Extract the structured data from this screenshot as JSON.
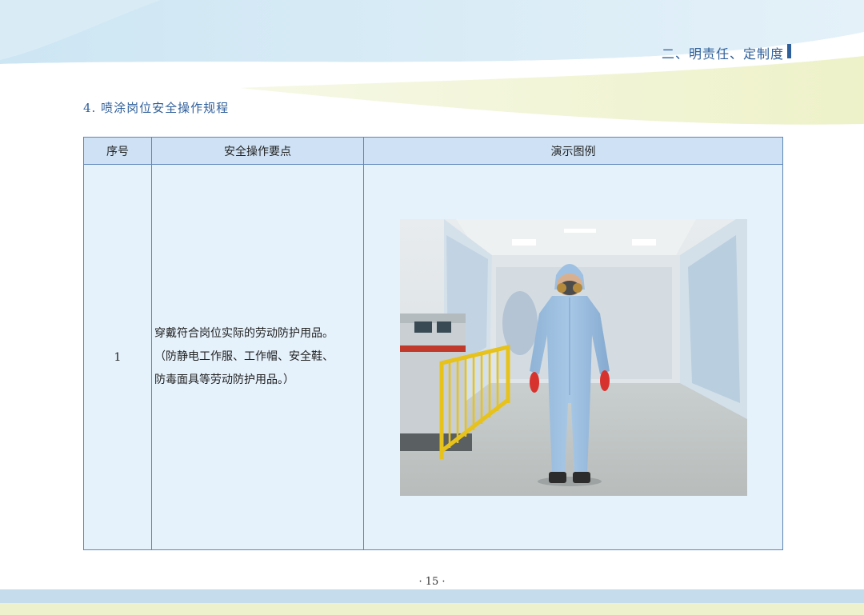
{
  "header": {
    "chapter_title": "二、明责任、定制度",
    "chapter_mark": "Ⅱ"
  },
  "section": {
    "title": "4. 喷涂岗位安全操作规程"
  },
  "table": {
    "headers": [
      "序号",
      "安全操作要点",
      "演示图例"
    ],
    "rows": [
      {
        "no": "1",
        "lines": [
          "穿戴符合岗位实际的劳动防护用品。",
          "（防静电工作服、工作帽、安全鞋、",
          "防毒面具等劳动防护用品。）"
        ],
        "image": "spray-booth-worker-in-protective-suit"
      }
    ]
  },
  "footer": {
    "page_number": "· 15 ·"
  },
  "colors": {
    "accent": "#2f5f9a",
    "table_header_bg": "#cfe2f5",
    "table_body_bg": "#e5f1fb",
    "border": "#5f86b8"
  }
}
